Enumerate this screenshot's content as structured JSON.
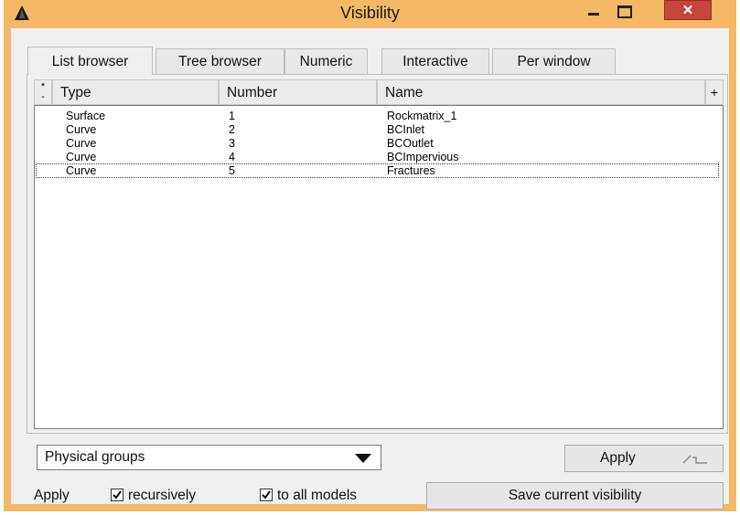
{
  "window": {
    "title": "Visibility",
    "close_glyph": "✕",
    "minimize_icon": "minimize-icon",
    "maximize_icon": "maximize-icon",
    "app_icon": "gmsh-triangle-icon"
  },
  "tabs": [
    {
      "label": "List browser",
      "active": true
    },
    {
      "label": "Tree browser",
      "active": false
    },
    {
      "label": "Numeric",
      "active": false
    },
    {
      "label": "Interactive",
      "active": false
    },
    {
      "label": "Per window",
      "active": false
    }
  ],
  "table": {
    "sort_button": "*\n-",
    "columns": [
      "Type",
      "Number",
      "Name"
    ],
    "add_column_button": "+",
    "rows": [
      {
        "type": "Surface",
        "number": "1",
        "name": "Rockmatrix_1",
        "selected": false
      },
      {
        "type": "Curve",
        "number": "2",
        "name": "BCInlet",
        "selected": false
      },
      {
        "type": "Curve",
        "number": "3",
        "name": "BCOutlet",
        "selected": false
      },
      {
        "type": "Curve",
        "number": "4",
        "name": "BCImpervious",
        "selected": false
      },
      {
        "type": "Curve",
        "number": "5",
        "name": "Fractures",
        "selected": true
      }
    ]
  },
  "group_select": {
    "value": "Physical groups"
  },
  "apply_button": {
    "label": "Apply"
  },
  "bottom": {
    "apply_label": "Apply",
    "recursively_label": "recursively",
    "recursively_checked": true,
    "all_models_label": "to all models",
    "all_models_checked": true,
    "save_label": "Save current visibility"
  },
  "colors": {
    "titlebar": "#f5b866",
    "close_button": "#c7453a",
    "panel_bg": "#f0f0f0"
  }
}
